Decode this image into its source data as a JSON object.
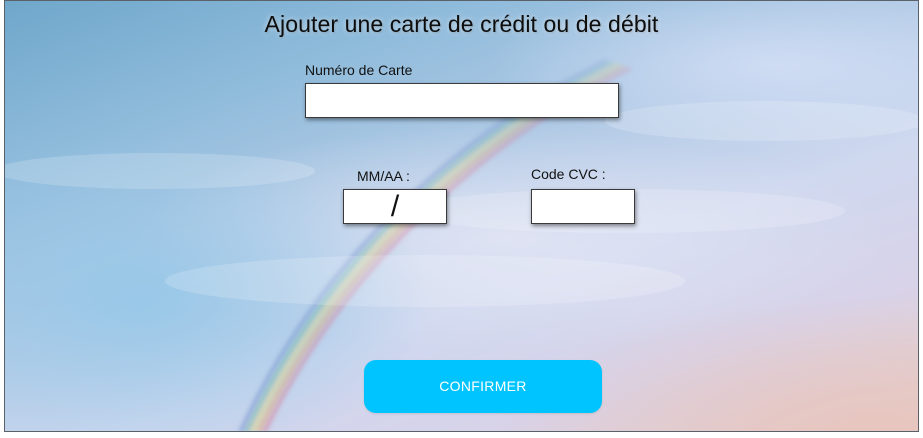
{
  "page": {
    "title": "Ajouter une carte de crédit ou de débit"
  },
  "form": {
    "card_number": {
      "label": "Numéro de Carte",
      "value": "",
      "placeholder": ""
    },
    "expiry": {
      "label": "MM/AA :",
      "separator": "/",
      "value": ""
    },
    "cvc": {
      "label": "Code CVC :",
      "value": ""
    },
    "confirm_label": "CONFIRMER"
  },
  "colors": {
    "button": "#00c4ff",
    "button_text": "#ffffff",
    "field_bg": "#ffffff"
  }
}
